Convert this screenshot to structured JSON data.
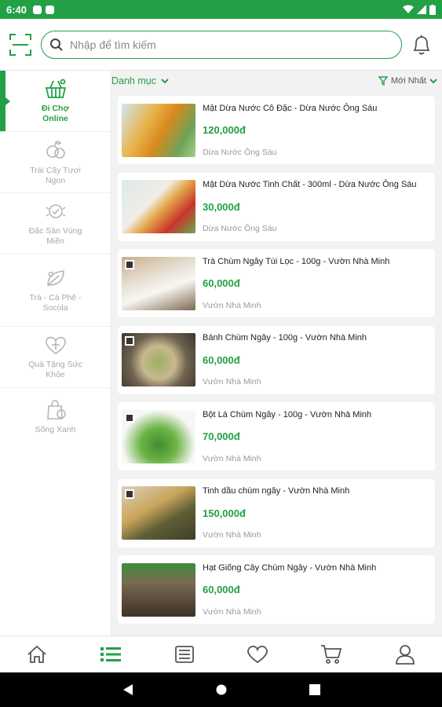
{
  "status_bar": {
    "time": "6:40"
  },
  "search": {
    "placeholder": "Nhập để tìm kiếm"
  },
  "sidebar": {
    "categories": [
      {
        "label": "Đi Chợ Online",
        "icon": "basket-icon",
        "active": true
      },
      {
        "label": "Trái Cây Tươi Ngon",
        "icon": "fruit-icon",
        "active": false
      },
      {
        "label": "Đặc Sản Vùng Miền",
        "icon": "specialty-icon",
        "active": false
      },
      {
        "label": "Trà - Cà Phê - Socola",
        "icon": "leaf-icon",
        "active": false
      },
      {
        "label": "Quà Tặng Sức Khỏe",
        "icon": "gift-heart-icon",
        "active": false
      },
      {
        "label": "Sống Xanh",
        "icon": "eco-bag-icon",
        "active": false
      }
    ]
  },
  "filters": {
    "category_label": "Danh mục",
    "sort_label": "Mới Nhất"
  },
  "products": [
    {
      "name": "Mật Dừa Nước Cô Đặc - Dừa Nước Ông Sáu",
      "price": "120,000đ",
      "shop": "Dừa Nước Ông Sáu"
    },
    {
      "name": "Mật Dừa Nước Tinh Chất - 300ml - Dừa Nước Ông Sáu",
      "price": "30,000đ",
      "shop": "Dừa Nước Ông Sáu"
    },
    {
      "name": "Trà Chùm Ngây Túi Lọc - 100g - Vườn Nhà Minh",
      "price": "60,000đ",
      "shop": "Vườn Nhà Minh"
    },
    {
      "name": "Bánh Chùm Ngây - 100g - Vườn Nhà Minh",
      "price": "60,000đ",
      "shop": "Vườn Nhà Minh"
    },
    {
      "name": "Bột Lá Chùm Ngây - 100g - Vườn Nhà Minh",
      "price": "70,000đ",
      "shop": "Vườn Nhà Minh"
    },
    {
      "name": "Tinh dầu chùm ngây - Vườn Nhà Minh",
      "price": "150,000đ",
      "shop": "Vườn Nhà Minh"
    },
    {
      "name": "Hạt Giống Cây Chùm Ngây - Vườn Nhà Minh",
      "price": "60,000đ",
      "shop": "Vườn Nhà Minh"
    }
  ],
  "bottom_nav": [
    "home-icon",
    "list-icon",
    "news-icon",
    "heart-icon",
    "cart-icon",
    "user-icon"
  ],
  "colors": {
    "primary": "#22a046",
    "muted": "#a8a8a8"
  }
}
